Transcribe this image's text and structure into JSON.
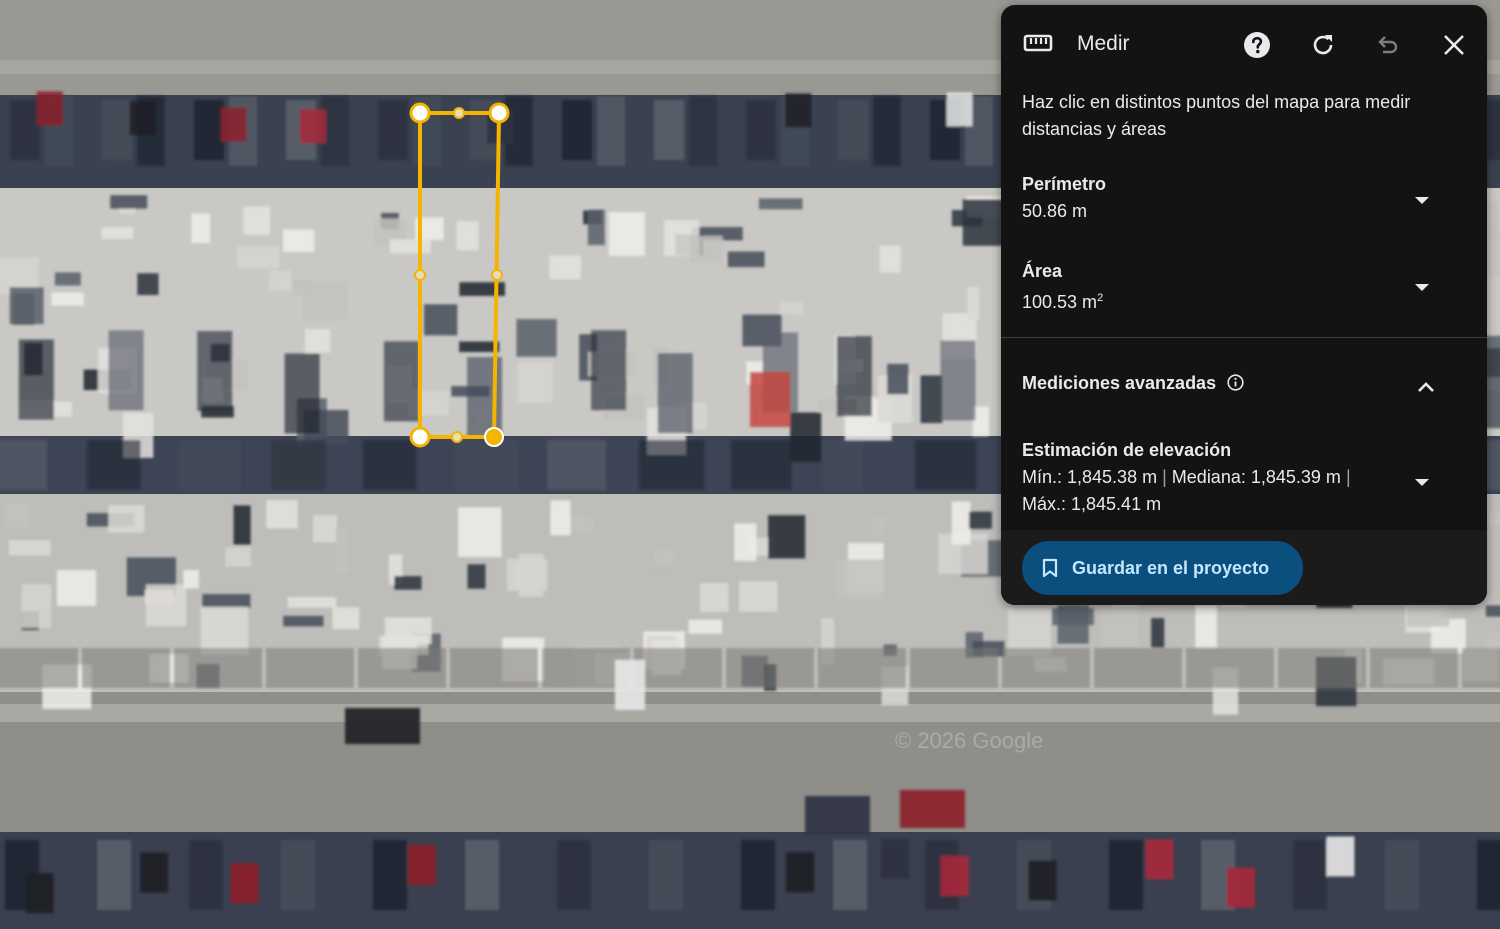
{
  "panel": {
    "title": "Medir",
    "instructions": "Haz clic en distintos puntos del mapa para medir distancias y áreas",
    "perimeter": {
      "label": "Perímetro",
      "value": "50.86 m"
    },
    "area": {
      "label": "Área",
      "value": "100.53 m",
      "unit_sup": "2"
    },
    "advanced": {
      "label": "Mediciones avanzadas",
      "expanded": true
    },
    "elevation": {
      "label": "Estimación de elevación",
      "min": "Mín.: 1,845.38 m",
      "median": "Mediana: 1,845.39 m",
      "max": "Máx.: 1,845.41 m",
      "separator": "|"
    },
    "save_button": "Guardar en el proyecto",
    "icons": {
      "ruler": "ruler-icon",
      "help": "help-icon",
      "refresh": "refresh-icon",
      "undo": "undo-icon",
      "close": "close-icon",
      "info": "info-icon",
      "bookmark": "bookmark-icon"
    },
    "colors": {
      "panel_bg": "#131314",
      "save_bg": "#0b4f7e",
      "save_text": "#c2e7ff",
      "measure_line": "#f4b400"
    }
  },
  "map": {
    "watermark": "© 2026 Google",
    "measured_shape": "polygon"
  }
}
